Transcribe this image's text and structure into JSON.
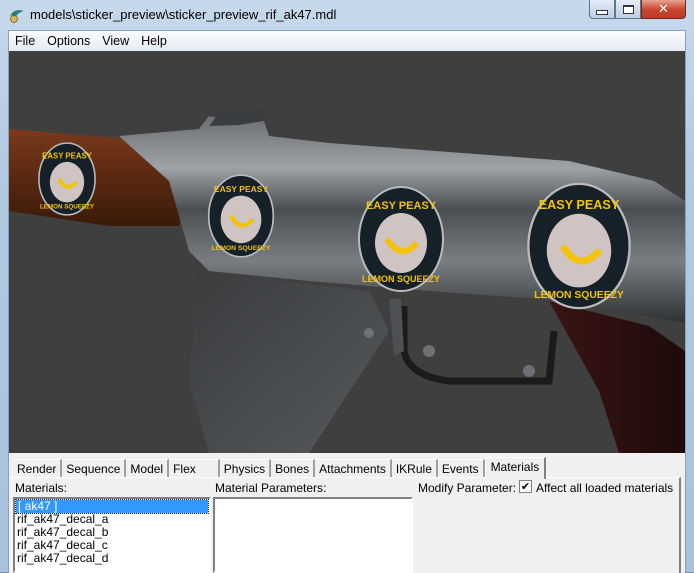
{
  "window": {
    "title": "models\\sticker_preview\\sticker_preview_rif_ak47.mdl",
    "icon": "hlmv-app-icon",
    "controls": {
      "minimize": "minimize-icon",
      "maximize": "maximize-icon",
      "close": "close-icon"
    }
  },
  "menubar": {
    "items": [
      {
        "label": "File"
      },
      {
        "label": "Options"
      },
      {
        "label": "View"
      },
      {
        "label": "Help"
      }
    ]
  },
  "viewport": {
    "description": "3D model preview: AK-47 with four 'Easy Peasy Lemon Squeezy' stickers",
    "background_color": "#3f3f3f",
    "stickers": [
      {
        "top_text": "EASY PEASY",
        "bottom_text": "LEMON SQUEEZY"
      },
      {
        "top_text": "EASY PEASY",
        "bottom_text": "LEMON SQUEEZY"
      },
      {
        "top_text": "EASY PEASY",
        "bottom_text": "LEMON SQUEEZY"
      },
      {
        "top_text": "EASY PEASY",
        "bottom_text": "LEMON SQUEEZY"
      }
    ]
  },
  "tabs": [
    {
      "label": "Render",
      "active": false
    },
    {
      "label": "Sequence",
      "active": false
    },
    {
      "label": "Model",
      "active": false
    },
    {
      "label": "Flex",
      "active": false
    },
    {
      "label": "Physics",
      "active": false
    },
    {
      "label": "Bones",
      "active": false
    },
    {
      "label": "Attachments",
      "active": false
    },
    {
      "label": "IKRule",
      "active": false
    },
    {
      "label": "Events",
      "active": false
    },
    {
      "label": "Materials",
      "active": true
    }
  ],
  "materials_panel": {
    "materials_label": "Materials:",
    "materials": [
      {
        "name": "[ ak47 ]",
        "selected": true
      },
      {
        "name": "rif_ak47_decal_a",
        "selected": false
      },
      {
        "name": "rif_ak47_decal_b",
        "selected": false
      },
      {
        "name": "rif_ak47_decal_c",
        "selected": false
      },
      {
        "name": "rif_ak47_decal_d",
        "selected": false
      }
    ],
    "parameters_label": "Material Parameters:",
    "modify_label": "Modify Parameter:",
    "affect_all": {
      "label": "Affect all loaded materials",
      "checked": true,
      "check_glyph": "✔"
    }
  }
}
